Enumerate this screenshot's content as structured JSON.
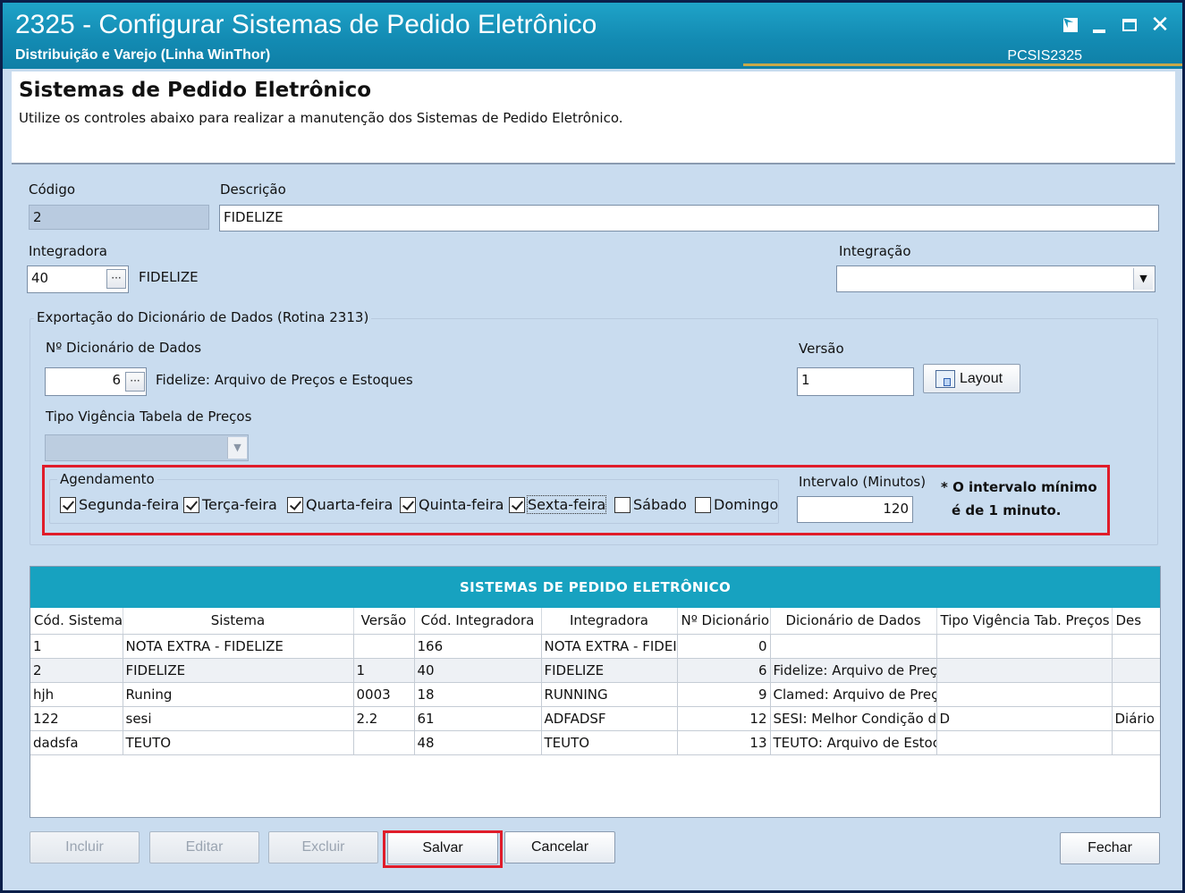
{
  "window": {
    "title": "2325 - Configurar Sistemas de Pedido Eletrônico",
    "subtitle": "Distribuição e Varejo (Linha WinThor)",
    "code": "PCSIS2325",
    "controls": {
      "restore": "◪",
      "minimize": "_",
      "maximize": "□",
      "close": "✕"
    }
  },
  "header": {
    "title": "Sistemas de Pedido Eletrônico",
    "description": "Utilize os controles abaixo para realizar a manutenção dos Sistemas de Pedido Eletrônico."
  },
  "form": {
    "codigo_label": "Código",
    "codigo_value": "2",
    "descricao_label": "Descrição",
    "descricao_value": "FIDELIZE",
    "integradora_label": "Integradora",
    "integradora_value": "40",
    "integradora_name": "FIDELIZE",
    "integracao_label": "Integração",
    "integracao_value": "",
    "ellipsis": "···"
  },
  "exportacao": {
    "group_title": "Exportação do Dicionário de Dados (Rotina 2313)",
    "dicionario_label": "Nº Dicionário de Dados",
    "dicionario_value": "6",
    "dicionario_name": "Fidelize: Arquivo de Preços e Estoques",
    "versao_label": "Versão",
    "versao_value": "1",
    "layout_button": "Layout",
    "tipo_vigencia_label": "Tipo Vigência Tabela de Preços",
    "tipo_vigencia_value": ""
  },
  "agendamento": {
    "group_title": "Agendamento",
    "days": [
      {
        "label": "Segunda-feira",
        "checked": true
      },
      {
        "label": "Terça-feira",
        "checked": true
      },
      {
        "label": "Quarta-feira",
        "checked": true
      },
      {
        "label": "Quinta-feira",
        "checked": true
      },
      {
        "label": "Sexta-feira",
        "checked": true
      },
      {
        "label": "Sábado",
        "checked": false
      },
      {
        "label": "Domingo",
        "checked": false
      }
    ],
    "intervalo_label": "Intervalo (Minutos)",
    "intervalo_value": "120",
    "note_line1": "* O intervalo mínimo",
    "note_line2": "é de 1 minuto."
  },
  "grid": {
    "title": "SISTEMAS DE PEDIDO ELETRÔNICO",
    "columns": [
      "Cód. Sistema",
      "Sistema",
      "Versão",
      "Cód. Integradora",
      "Integradora",
      "Nº Dicionário",
      "Dicionário de Dados",
      "Tipo Vigência Tab. Preços",
      "Des"
    ],
    "rows": [
      [
        "1",
        "NOTA EXTRA - FIDELIZE",
        "",
        "166",
        "NOTA EXTRA - FIDEI",
        "0",
        "",
        "",
        ""
      ],
      [
        "2",
        "FIDELIZE",
        "1",
        "40",
        "FIDELIZE",
        "6",
        "Fidelize: Arquivo de Preço",
        "",
        ""
      ],
      [
        "hjh",
        "Runing",
        "0003",
        "18",
        "RUNNING",
        "9",
        "Clamed: Arquivo de Preço",
        "",
        ""
      ],
      [
        "122",
        "sesi",
        "2.2",
        "61",
        "ADFADSF",
        "12",
        "SESI: Melhor Condição de",
        "D",
        "Diário"
      ],
      [
        "dadsfa",
        "TEUTO",
        "",
        "48",
        "TEUTO",
        "13",
        "TEUTO: Arquivo de Estoc",
        "",
        ""
      ]
    ],
    "selected_row": 1
  },
  "buttons": {
    "incluir": "Incluir",
    "editar": "Editar",
    "excluir": "Excluir",
    "salvar": "Salvar",
    "cancelar": "Cancelar",
    "fechar": "Fechar"
  },
  "colors": {
    "titlebar": "#138bb3",
    "grid_header": "#17a2c0",
    "highlight": "#e01c2a",
    "background": "#c9dcef"
  }
}
